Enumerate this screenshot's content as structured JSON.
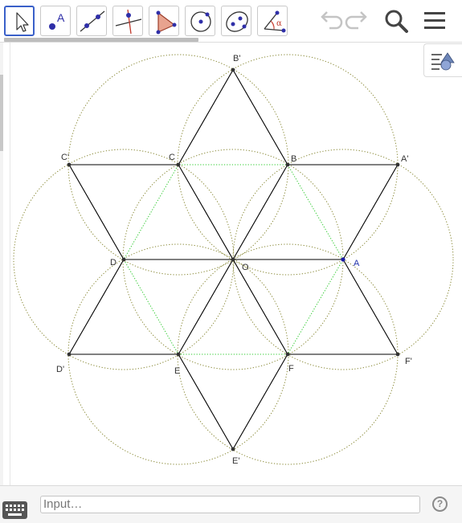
{
  "toolbar": {
    "tools": [
      {
        "name": "move-tool",
        "icon": "arrow-pointer-icon",
        "selected": true
      },
      {
        "name": "point-tool",
        "icon": "point-icon",
        "label": "A"
      },
      {
        "name": "line-tool",
        "icon": "line-icon"
      },
      {
        "name": "perpendicular-line-tool",
        "icon": "perpendicular-icon"
      },
      {
        "name": "polygon-tool",
        "icon": "polygon-icon"
      },
      {
        "name": "circle-tool",
        "icon": "circle-with-center-icon"
      },
      {
        "name": "conic-tool",
        "icon": "ellipse-icon"
      },
      {
        "name": "angle-tool",
        "icon": "angle-icon",
        "label": "α"
      }
    ],
    "undo_icon": "undo-icon",
    "redo_icon": "redo-icon",
    "search_icon": "search-icon",
    "menu_icon": "hamburger-menu-icon"
  },
  "graphics": {
    "style_bar_icon": "style-bar-toggle-icon",
    "points": {
      "A": "A",
      "B": "B",
      "C": "C",
      "D": "D",
      "E": "E",
      "F": "F",
      "O": "O",
      "A_prime": "A'",
      "B_prime": "B'",
      "C_prime": "C'",
      "D_prime": "D'",
      "E_prime": "E'",
      "F_prime": "F'"
    },
    "colors": {
      "segment": "#000000",
      "circle": "#8b8b3a",
      "hexagon": "#33cc33",
      "point_free": "#1a1aa6",
      "point_dependent": "#333333"
    }
  },
  "input_bar": {
    "placeholder": "Input…",
    "help_label": "?",
    "keyboard_icon": "keyboard-icon"
  }
}
